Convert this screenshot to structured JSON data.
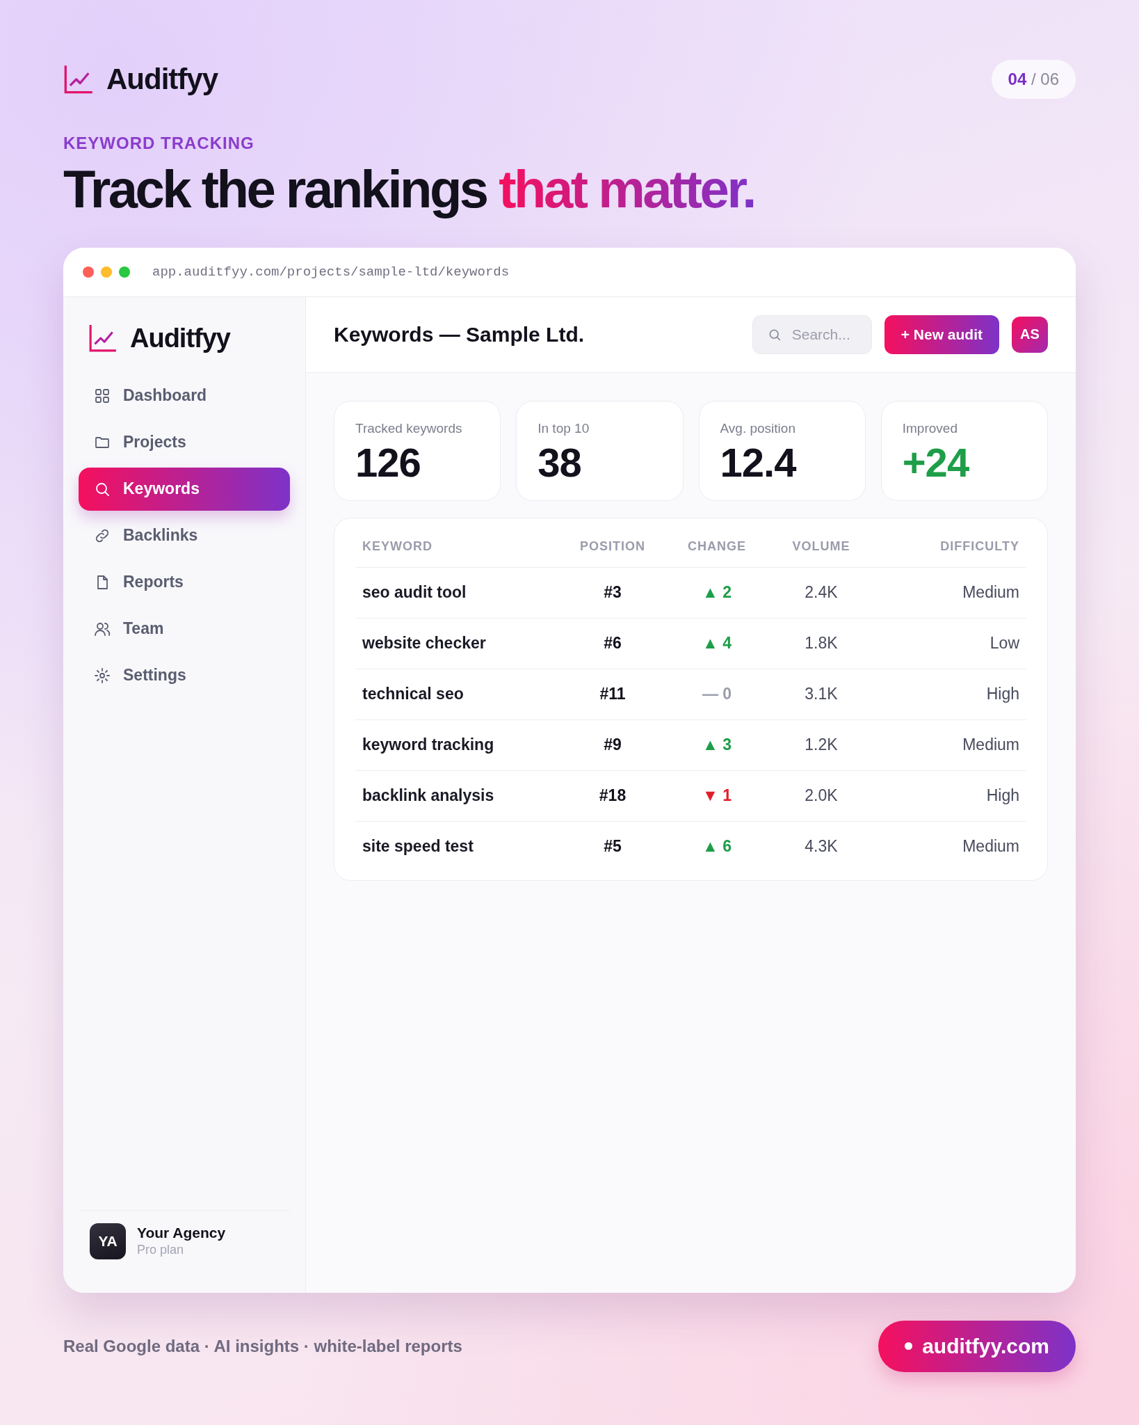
{
  "brand": {
    "name": "Auditfyy"
  },
  "pager": {
    "current": "04",
    "total": "/ 06"
  },
  "eyebrow": "KEYWORD TRACKING",
  "headline": {
    "text": "Track the rankings",
    "highlight": "that matter."
  },
  "browser": {
    "url": "app.auditfyy.com/projects/sample-ltd/keywords"
  },
  "sidebar": {
    "brand": "Auditfyy",
    "items": [
      {
        "label": "Dashboard",
        "selected": false
      },
      {
        "label": "Projects",
        "selected": false
      },
      {
        "label": "Keywords",
        "selected": true
      },
      {
        "label": "Backlinks",
        "selected": false
      },
      {
        "label": "Reports",
        "selected": false
      },
      {
        "label": "Team",
        "selected": false
      },
      {
        "label": "Settings",
        "selected": false
      }
    ],
    "account": {
      "initials": "YA",
      "name": "Your Agency",
      "plan": "Pro plan"
    }
  },
  "header": {
    "title": "Keywords — Sample Ltd.",
    "search": {
      "placeholder": "Search..."
    },
    "button": "+ New audit",
    "avatar": "AS"
  },
  "stats": [
    {
      "label": "Tracked keywords",
      "value": "126",
      "kind": "neutral"
    },
    {
      "label": "In top 10",
      "value": "38",
      "kind": "neutral"
    },
    {
      "label": "Avg. position",
      "value": "12.4",
      "kind": "neutral"
    },
    {
      "label": "Improved",
      "value": "+24",
      "kind": "positive"
    }
  ],
  "table": {
    "columns": [
      "KEYWORD",
      "POSITION",
      "CHANGE",
      "VOLUME",
      "DIFFICULTY"
    ],
    "rows": [
      {
        "keyword": "seo audit tool",
        "position": "#3",
        "change": {
          "kind": "up",
          "arrow": "▲",
          "value": "2"
        },
        "volume": "2.4K",
        "difficulty": "Medium"
      },
      {
        "keyword": "website checker",
        "position": "#6",
        "change": {
          "kind": "up",
          "arrow": "▲",
          "value": "4"
        },
        "volume": "1.8K",
        "difficulty": "Low"
      },
      {
        "keyword": "technical seo",
        "position": "#11",
        "change": {
          "kind": "flat",
          "arrow": "—",
          "value": "0"
        },
        "volume": "3.1K",
        "difficulty": "High"
      },
      {
        "keyword": "keyword tracking",
        "position": "#9",
        "change": {
          "kind": "up",
          "arrow": "▲",
          "value": "3"
        },
        "volume": "1.2K",
        "difficulty": "Medium"
      },
      {
        "keyword": "backlink analysis",
        "position": "#18",
        "change": {
          "kind": "down",
          "arrow": "▼",
          "value": "1"
        },
        "volume": "2.0K",
        "difficulty": "High"
      },
      {
        "keyword": "site speed test",
        "position": "#5",
        "change": {
          "kind": "up",
          "arrow": "▲",
          "value": "6"
        },
        "volume": "4.3K",
        "difficulty": "Medium"
      }
    ]
  },
  "footer": {
    "tagline": "Real Google data · AI insights · white-label reports",
    "link": "auditfyy.com"
  }
}
